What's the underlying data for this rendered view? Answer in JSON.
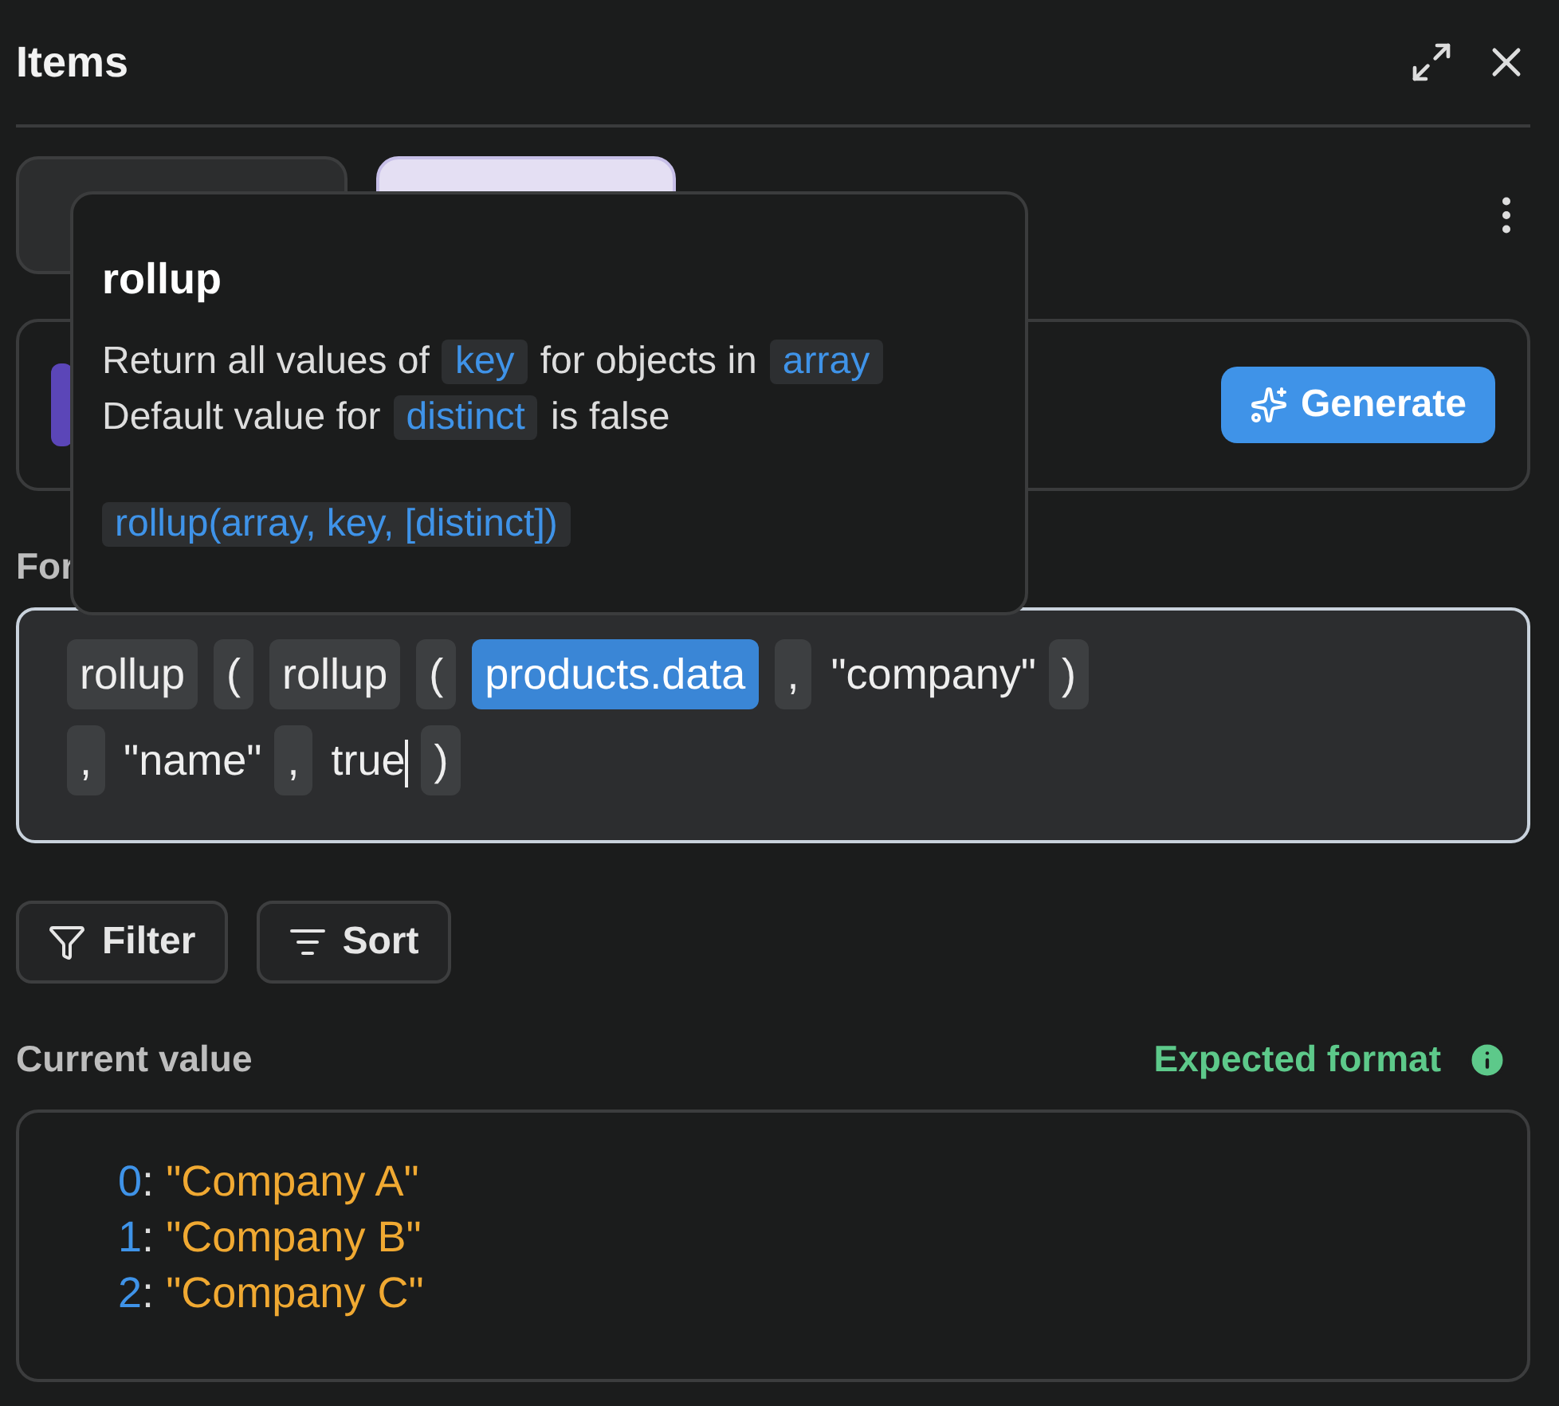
{
  "panel": {
    "title": "Items"
  },
  "formula_label": "For",
  "generate_button": "Generate",
  "formula_lines": [
    [
      {
        "text": "rollup",
        "kind": "chip"
      },
      {
        "text": "(",
        "kind": "chip"
      },
      {
        "text": "rollup",
        "kind": "chip"
      },
      {
        "text": "(",
        "kind": "chip"
      },
      {
        "text": "products.data",
        "kind": "highlight"
      },
      {
        "text": ",",
        "kind": "chip"
      },
      {
        "text": "\"company\"",
        "kind": "plain"
      },
      {
        "text": ")",
        "kind": "chip"
      }
    ],
    [
      {
        "text": ",",
        "kind": "chip"
      },
      {
        "text": "\"name\"",
        "kind": "plain"
      },
      {
        "text": ",",
        "kind": "chip"
      },
      {
        "text": "true",
        "kind": "plain",
        "caret": true
      },
      {
        "text": ")",
        "kind": "chip"
      }
    ]
  ],
  "tool_buttons": [
    {
      "label": "Filter",
      "kind": "filter"
    },
    {
      "label": "Sort",
      "kind": "sort"
    }
  ],
  "current_value": {
    "label": "Current value",
    "expected_format": "Expected format",
    "items": [
      {
        "index": "0",
        "separator": ":",
        "value": "\"Company A\""
      },
      {
        "index": "1",
        "separator": ":",
        "value": "\"Company B\""
      },
      {
        "index": "2",
        "separator": ":",
        "value": "\"Company C\""
      }
    ]
  },
  "tooltip": {
    "title": "rollup",
    "lines": [
      [
        {
          "text": "Return all values of",
          "code": false
        },
        {
          "text": "key",
          "code": true
        },
        {
          "text": "for objects in",
          "code": false
        },
        {
          "text": "array",
          "code": true
        }
      ],
      [
        {
          "text": "Default value for",
          "code": false
        },
        {
          "text": "distinct",
          "code": true
        },
        {
          "text": "is false",
          "code": false
        }
      ]
    ],
    "signature": "rollup(array, key, [distinct])"
  }
}
